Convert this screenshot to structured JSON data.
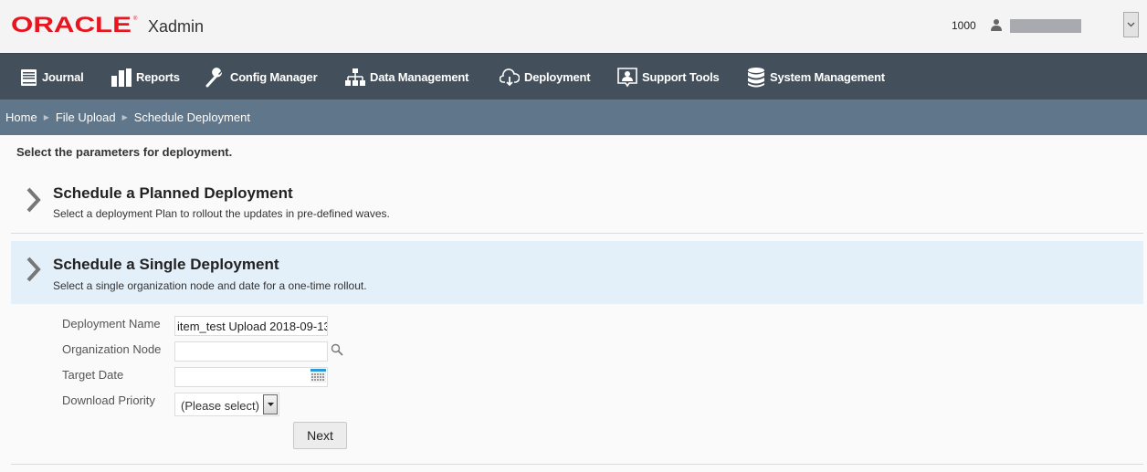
{
  "header": {
    "brand": "ORACLE",
    "app_title": "Xadmin",
    "user_number": "1000",
    "user_icon": "person-icon",
    "user_menu_icon": "chevron-down-icon",
    "brand_color": "#e8141e"
  },
  "nav": {
    "items": [
      {
        "label": "Journal",
        "icon": "book-icon"
      },
      {
        "label": "Reports",
        "icon": "bar-chart-icon"
      },
      {
        "label": "Config Manager",
        "icon": "wrench-icon"
      },
      {
        "label": "Data Management",
        "icon": "hierarchy-icon"
      },
      {
        "label": "Deployment",
        "icon": "cloud-download-icon"
      },
      {
        "label": "Support Tools",
        "icon": "support-icon"
      },
      {
        "label": "System Management",
        "icon": "database-icon"
      }
    ]
  },
  "breadcrumb": {
    "items": [
      "Home",
      "File Upload",
      "Schedule Deployment"
    ],
    "separator": "▶"
  },
  "main": {
    "instruction": "Select the parameters for deployment.",
    "options": [
      {
        "title": "Schedule a Planned Deployment",
        "description": "Select a deployment Plan to rollout the updates in pre-defined waves."
      },
      {
        "title": "Schedule a Single Deployment",
        "description": "Select a single organization node and date for a one-time rollout."
      }
    ],
    "form": {
      "deployment_name_label": "Deployment Name",
      "deployment_name_value": "item_test Upload 2018-09-13",
      "org_node_label": "Organization Node",
      "org_node_value": "",
      "target_date_label": "Target Date",
      "target_date_value": "",
      "priority_label": "Download Priority",
      "priority_value": "(Please select)",
      "next_label": "Next"
    }
  }
}
